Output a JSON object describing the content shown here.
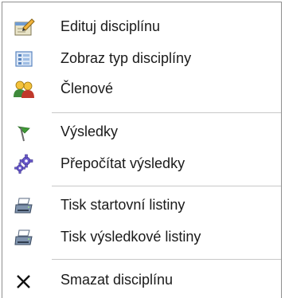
{
  "menu": {
    "items": [
      {
        "label": "Edituj disciplínu",
        "icon": "edit-discipline-icon"
      },
      {
        "label": "Zobraz typ disciplíny",
        "icon": "view-type-icon"
      },
      {
        "label": "Členové",
        "icon": "members-icon"
      },
      {
        "label": "Výsledky",
        "icon": "results-flag-icon"
      },
      {
        "label": "Přepočítat výsledky",
        "icon": "recalculate-gear-icon"
      },
      {
        "label": "Tisk startovní listiny",
        "icon": "printer-icon"
      },
      {
        "label": "Tisk výsledkové listiny",
        "icon": "printer-icon"
      },
      {
        "label": "Smazat disciplínu",
        "icon": "delete-x-icon"
      }
    ]
  }
}
